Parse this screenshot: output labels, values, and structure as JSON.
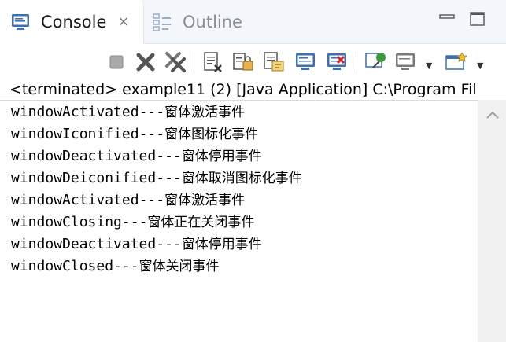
{
  "tabs": {
    "console_label": "Console",
    "close_glyph": "⨯",
    "outline_label": "Outline"
  },
  "window_controls": [
    "minimize-icon",
    "maximize-icon"
  ],
  "toolbar": {
    "icons": [
      "terminate-icon",
      "remove-launch-icon",
      "remove-all-terminated-icon",
      "clear-console-icon",
      "scroll-lock-icon",
      "word-wrap-icon",
      "show-on-stdout-icon",
      "show-on-stderr-icon",
      "pin-console-icon",
      "display-console-icon",
      "open-console-icon"
    ]
  },
  "status": {
    "text": "<terminated> example11 (2) [Java Application] C:\\Program Fil"
  },
  "console": {
    "lines": [
      {
        "event": "windowActivated",
        "sep": "---",
        "desc": "窗体激活事件"
      },
      {
        "event": "windowIconified",
        "sep": "---",
        "desc": "窗体图标化事件"
      },
      {
        "event": "windowDeactivated",
        "sep": "---",
        "desc": "窗体停用事件"
      },
      {
        "event": "windowDeiconified",
        "sep": "---",
        "desc": "窗体取消图标化事件"
      },
      {
        "event": "windowActivated",
        "sep": "---",
        "desc": "窗体激活事件"
      },
      {
        "event": "windowClosing",
        "sep": "---",
        "desc": "窗体正在关闭事件"
      },
      {
        "event": "windowDeactivated",
        "sep": "---",
        "desc": "窗体停用事件"
      },
      {
        "event": "windowClosed",
        "sep": "---",
        "desc": "窗体关闭事件"
      }
    ]
  },
  "colors": {
    "tab_bg": "#f3f6fa",
    "accent_blue": "#3b6fb6",
    "text": "#000000"
  }
}
